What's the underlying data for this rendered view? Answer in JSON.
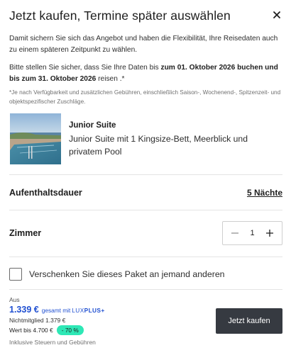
{
  "dialog": {
    "title": "Jetzt kaufen, Termine später auswählen",
    "close_icon": "close-icon"
  },
  "intro": {
    "text": "Damit sichern Sie sich das Angebot und haben die Flexibilität, Ihre Reisedaten auch zu einem späteren Zeitpunkt zu wählen.",
    "dates_prefix": "Bitte stellen Sie sicher, dass Sie Ihre Daten bis ",
    "dates_bold": "zum 01. Oktober 2026 buchen und bis zum 31. Oktober 2026",
    "dates_suffix": " reisen .*",
    "note": "*Je nach Verfügbarkeit und zusätzlichen Gebühren, einschließlich Saison-, Wochenend-, Spitzenzeit- und objektspezifischer Zuschläge."
  },
  "room": {
    "name": "Junior Suite",
    "description": "Junior Suite mit 1 Kingsize-Bett, Meerblick und privatem Pool"
  },
  "stay": {
    "label": "Aufenthaltsdauer",
    "value": "5 Nächte"
  },
  "rooms": {
    "label": "Zimmer",
    "count": "1",
    "minus_icon": "minus-icon",
    "plus_icon": "plus-icon"
  },
  "gift": {
    "label": "Verschenken Sie dieses Paket an jemand anderen",
    "checked": false
  },
  "pricing": {
    "from_label": "Aus",
    "price": "1.339 €",
    "price_suffix": "gesamt mit",
    "lux_prefix": "LUX",
    "lux_bold": "PLUS+",
    "non_member": "Nichtmitglied 1.379 €",
    "worth": "Wert bis 4.700 €",
    "discount": "- 70 %",
    "includes": "Inklusive Steuern und Gebühren"
  },
  "actions": {
    "buy_label": "Jetzt kaufen"
  },
  "colors": {
    "accent_blue": "#1f4fd1",
    "discount_badge": "#2ee8b6",
    "button_bg": "#363a41"
  }
}
